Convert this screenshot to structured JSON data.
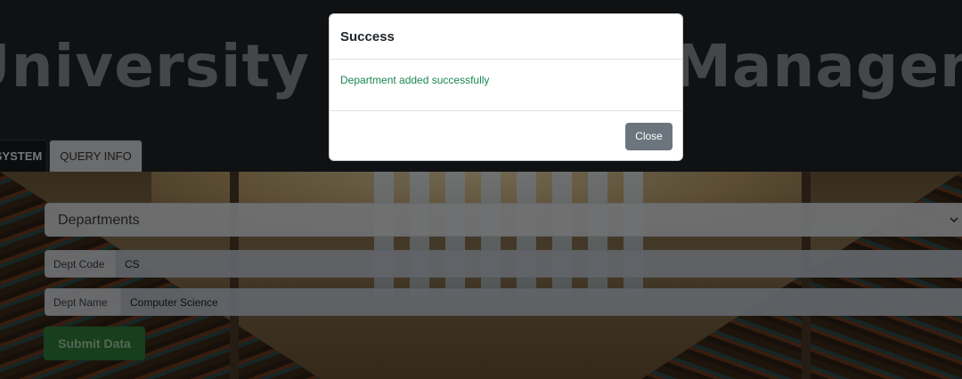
{
  "header": {
    "title": "University Database Management System"
  },
  "tabs": [
    {
      "label": "SYSTEM"
    },
    {
      "label": "QUERY INFO"
    }
  ],
  "form": {
    "select_value": "Departments",
    "dept_code_label": "Dept Code",
    "dept_code_value": "CS",
    "dept_name_label": "Dept Name",
    "dept_name_value": "Computer Science",
    "submit_label": "Submit Data"
  },
  "modal": {
    "title": "Success",
    "message": "Department added successfully",
    "close_label": "Close"
  },
  "colors": {
    "success_text": "#198754",
    "submit_button": "#2e7d3b",
    "close_button": "#6c757d"
  }
}
